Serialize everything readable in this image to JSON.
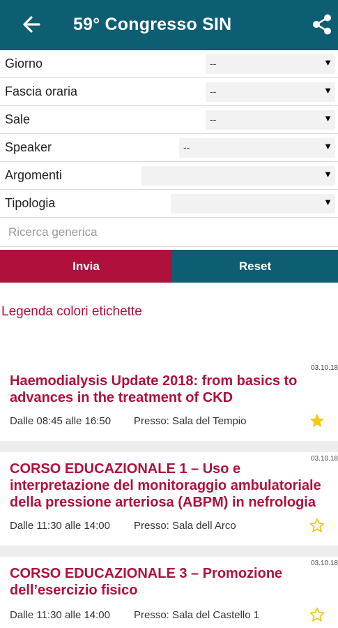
{
  "header": {
    "title": "59° Congresso SIN",
    "back_icon": "arrow-left-icon",
    "share_icon": "share-icon"
  },
  "filters": [
    {
      "label": "Giorno",
      "value": "--"
    },
    {
      "label": "Fascia oraria",
      "value": "--"
    },
    {
      "label": "Sale",
      "value": "--"
    },
    {
      "label": "Speaker",
      "value": "--"
    },
    {
      "label": "Argomenti",
      "value": ""
    },
    {
      "label": "Tipologia",
      "value": ""
    }
  ],
  "search": {
    "placeholder": "Ricerca generica"
  },
  "buttons": {
    "send": "Invia",
    "reset": "Reset"
  },
  "legend": "Legenda colori etichette",
  "events": [
    {
      "date": "03.10.18",
      "title": "Haemodialysis Update 2018: from basics to advances in the treatment of CKD",
      "time": "Dalle 08:45 alle 16:50",
      "place": "Presso: Sala del Tempio",
      "favorite": true
    },
    {
      "date": "03.10.18",
      "title": "CORSO EDUCAZIONALE 1 – Uso e interpretazione del monitoraggio ambulatoriale della pressione arteriosa (ABPM) in nefrologia",
      "time": "Dalle 11:30 alle 14:00",
      "place": "Presso: Sala dell Arco",
      "favorite": false
    },
    {
      "date": "03.10.18",
      "title": "CORSO EDUCAZIONALE 3 – Promozione dell’esercizio fisico",
      "time": "Dalle 11:30 alle 14:00",
      "place": "Presso: Sala del Castello 1",
      "favorite": false
    }
  ],
  "colors": {
    "primary": "#0e5e73",
    "accent": "#b0103c",
    "star": "#f2c811"
  }
}
